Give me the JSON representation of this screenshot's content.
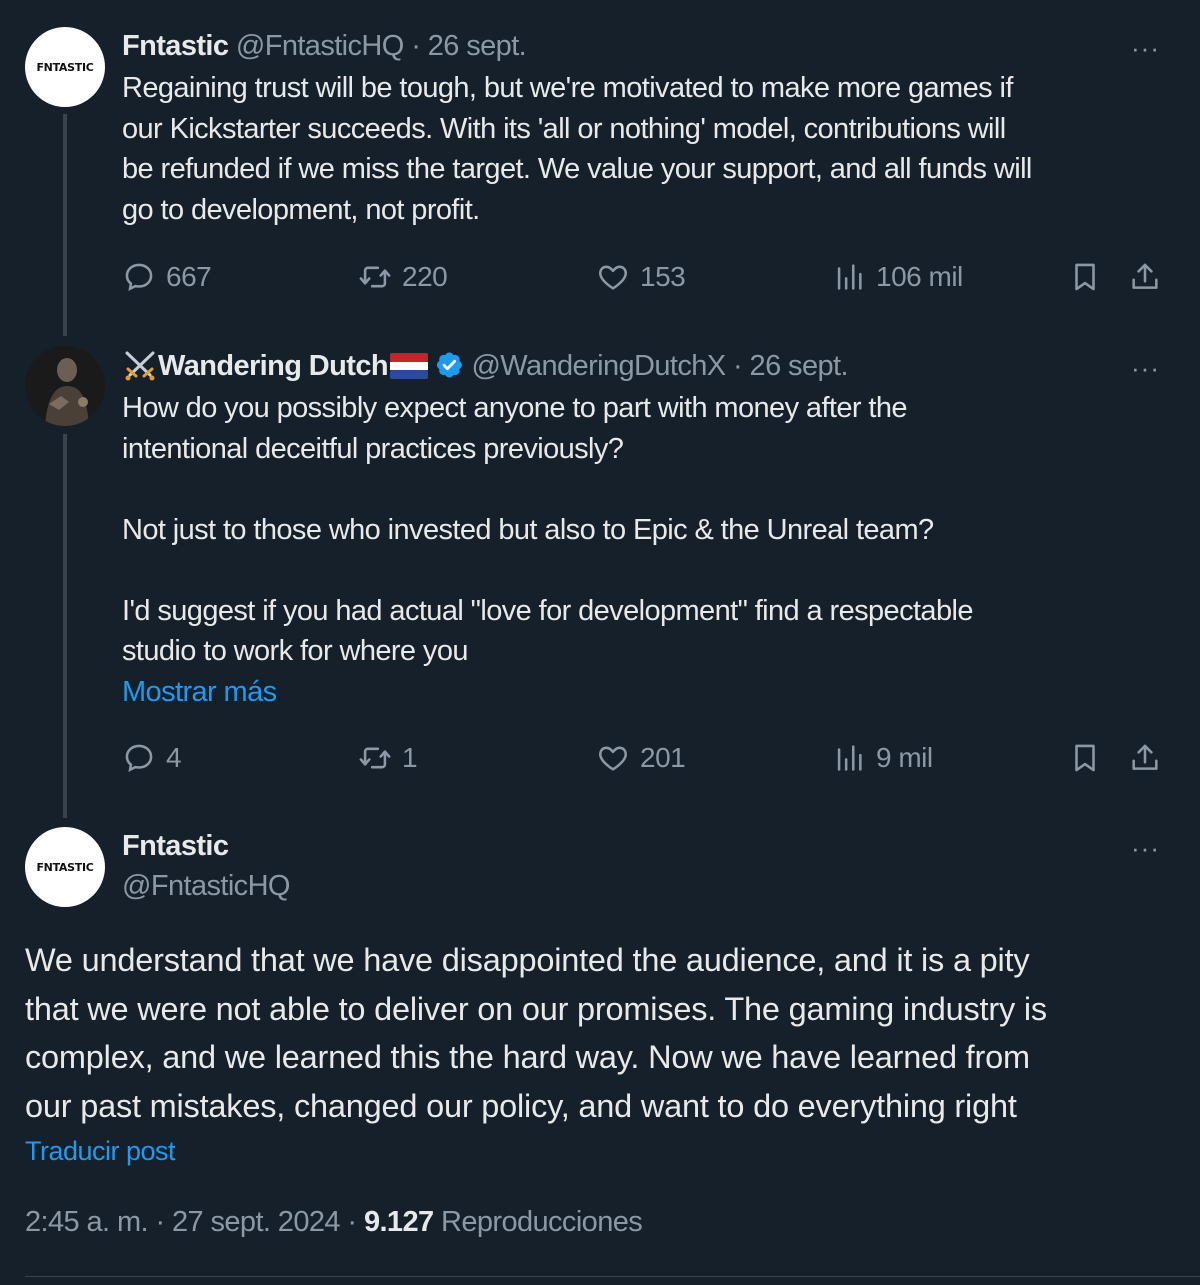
{
  "tweet1": {
    "avatar_text": "FNTASTIC",
    "name": "Fntastic",
    "handle": "@FntasticHQ",
    "separator": "·",
    "date": "26 sept.",
    "more": "···",
    "text": "Regaining trust will be tough, but we're motivated to make more games if\nour Kickstarter succeeds. With its 'all or nothing' model, contributions will\nbe refunded if we miss the target. We value your support, and all funds will\ngo to development, not profit.",
    "replies": "667",
    "reposts": "220",
    "likes": "153",
    "views": "106 mil"
  },
  "tweet2": {
    "name": "Wandering Dutch",
    "handle": "@WanderingDutchX",
    "separator": "·",
    "date": "26 sept.",
    "more": "···",
    "text": "How do you possibly expect anyone to part with money after the\nintentional deceitful practices previously?\n\nNot just to those who invested but also to Epic & the Unreal team?\n\nI'd suggest if you had actual \"love for development\" find a respectable\nstudio to work for where you",
    "show_more": "Mostrar más",
    "replies": "4",
    "reposts": "1",
    "likes": "201",
    "views": "9 mil"
  },
  "main_tweet": {
    "avatar_text": "FNTASTIC",
    "name": "Fntastic",
    "handle": "@FntasticHQ",
    "more": "···",
    "text": "We understand that we have disappointed the audience, and it is a pity\nthat we were not able to deliver on our promises. The gaming industry is\ncomplex, and we learned this the hard way. Now we have learned from\nour past mistakes, changed our policy, and want to do everything right",
    "translate": "Traducir post",
    "time": "2:45 a. m.",
    "separator": "·",
    "date": "27 sept. 2024",
    "views_count": "9.127",
    "views_label": "Reproducciones"
  },
  "colors": {
    "background": "#15202b",
    "text": "#e7e9ea",
    "muted": "#8b98a5",
    "link": "#1d9bf0",
    "thread_line": "#38444d"
  }
}
